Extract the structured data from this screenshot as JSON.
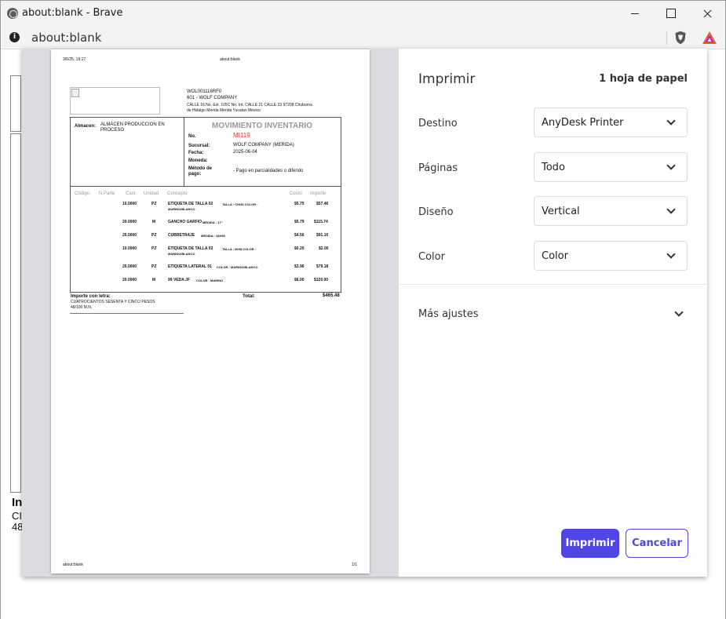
{
  "window": {
    "title": "about:blank - Brave"
  },
  "address_bar": {
    "url": "about:blank"
  },
  "background_page": {
    "frag1": "In",
    "frag2": "CI",
    "frag3": "48"
  },
  "document": {
    "header_left": "3/6/25, 19:17",
    "header_center": "about:blank",
    "code": "WOL001116RF0",
    "company": "601 - WOLF COMPANY",
    "address1": "CALLE 16 No. Ext. 105C No. Int. CALLE 21 CALLE 23 97208 Chuburna",
    "address2": "de Hidalgo Merida Merida Yucatan México",
    "almacen_label": "Almacen:",
    "almacen_value1": "ALMACEN PRODUCCION EN",
    "almacen_value2": "PROCESO",
    "doc_title": "MOVIMIENTO INVENTARIO",
    "no_label": "No.",
    "no_value": "MI119",
    "sucursal_label": "Sucursal:",
    "sucursal_value": "WOLF COMPANY (MERIDA)",
    "fecha_label": "Fecha:",
    "fecha_value": "2025-06-04",
    "moneda_label": "Moneda:",
    "metodo_label1": "Método de",
    "metodo_label2": "pago:",
    "metodo_value": "- Pago en parcialidades o diferido",
    "columns": [
      "Código",
      "N.Parte",
      "Cant.",
      "Unidad",
      "Concepto",
      "Costo",
      "Importe"
    ],
    "rows": [
      {
        "qty": "10.0000",
        "unit": "PZ",
        "concept": "ETIQUETA DE TALLA 02",
        "detail": "TALLA : CH/36 COLOR :",
        "detail2": "MARINO/BLANCO",
        "cost": "$5.75",
        "amount": "$57.46"
      },
      {
        "qty": "20.0000",
        "unit": "M",
        "concept": "GANCHO GARFIO",
        "detail": "MEDIDA : 17\"",
        "detail2": "",
        "cost": "$5.79",
        "amount": "$115.74"
      },
      {
        "qty": "20.0000",
        "unit": "PZ",
        "concept": "CUBRETRAJE",
        "detail": "MEDIDA : 48X98",
        "detail2": "",
        "cost": "$4.56",
        "amount": "$91.10"
      },
      {
        "qty": "10.0000",
        "unit": "PZ",
        "concept": "ETIQUETA DE TALLA 02",
        "detail": "TALLA : M/38 COLOR :",
        "detail2": "MARINO/BLANCO",
        "cost": "$0.20",
        "amount": "$2.00"
      },
      {
        "qty": "20.0000",
        "unit": "PZ",
        "concept": "ETIQUETA LATERAL 01",
        "detail": "COLOR : MARINO/BLANCO",
        "detail2": "",
        "cost": "$3.96",
        "amount": "$79.18"
      },
      {
        "qty": "20.0000",
        "unit": "M",
        "concept": "99 VEDA JF",
        "detail": "COLOR : MARINO",
        "detail2": "",
        "cost": "$6.00",
        "amount": "$120.00"
      }
    ],
    "importe_letra_label": "Importe con letra:",
    "importe_letra1": "CUATROCIENTOS SESENTA Y CINCO PESOS",
    "importe_letra2": "48/100 M.N.",
    "total_label": "Total:",
    "total_value": "$465.48",
    "footer_left": "about:blank",
    "footer_right": "1/1"
  },
  "print_panel": {
    "title": "Imprimir",
    "sheets": "1 hoja de papel",
    "destino_label": "Destino",
    "destino_value": "AnyDesk Printer",
    "paginas_label": "Páginas",
    "paginas_value": "Todo",
    "diseno_label": "Diseño",
    "diseno_value": "Vertical",
    "color_label": "Color",
    "color_value": "Color",
    "more_settings": "Más ajustes",
    "print_button": "Imprimir",
    "cancel_button": "Cancelar"
  },
  "colors": {
    "accent": "#4f46e5",
    "doc_number": "#e53935"
  }
}
